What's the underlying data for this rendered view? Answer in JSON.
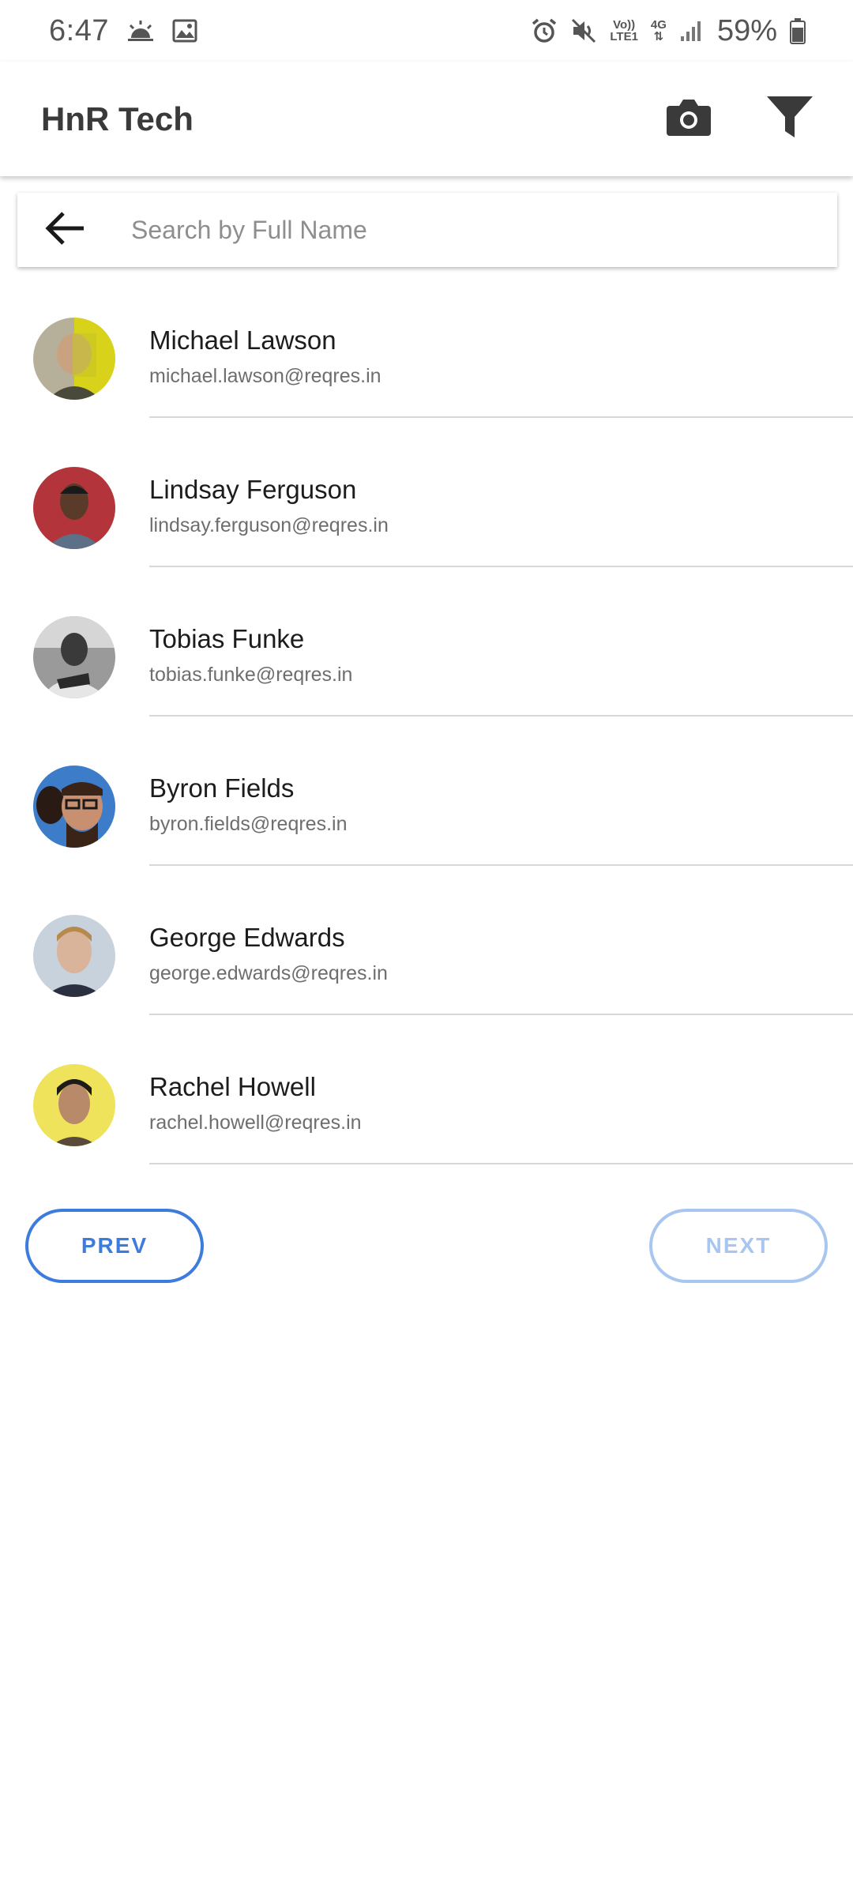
{
  "status_bar": {
    "time": "6:47",
    "volte_line1": "Vo))",
    "volte_line2": "LTE1",
    "network": "4G",
    "battery": "59%",
    "icons": [
      "weather-icon",
      "image-icon",
      "alarm-icon",
      "mute-icon",
      "signal-icon",
      "battery-icon"
    ]
  },
  "app_bar": {
    "title": "HnR Tech",
    "icons": [
      "camera-icon",
      "filter-icon"
    ]
  },
  "search": {
    "placeholder": "Search by Full Name",
    "value": ""
  },
  "users": [
    {
      "name": "Michael Lawson",
      "email": "michael.lawson@reqres.in"
    },
    {
      "name": "Lindsay Ferguson",
      "email": "lindsay.ferguson@reqres.in"
    },
    {
      "name": "Tobias Funke",
      "email": "tobias.funke@reqres.in"
    },
    {
      "name": "Byron Fields",
      "email": "byron.fields@reqres.in"
    },
    {
      "name": "George Edwards",
      "email": "george.edwards@reqres.in"
    },
    {
      "name": "Rachel Howell",
      "email": "rachel.howell@reqres.in"
    }
  ],
  "pagination": {
    "prev_label": "PREV",
    "next_label": "NEXT"
  },
  "colors": {
    "accent": "#3d7bdc",
    "accent_disabled": "#a9c6f1"
  }
}
